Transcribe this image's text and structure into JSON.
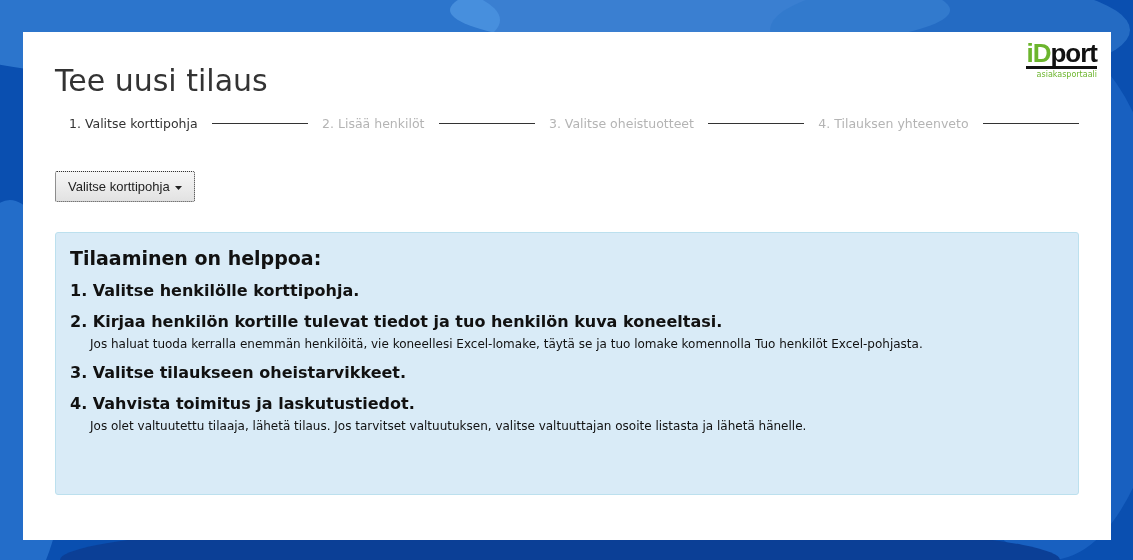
{
  "logo": {
    "brand_start": "iD",
    "brand_end": "port",
    "tagline": "asiakasportaali"
  },
  "title": "Tee uusi tilaus",
  "steps": [
    {
      "label": "1. Valitse korttipohja",
      "selected": true
    },
    {
      "label": "2. Lisää henkilöt",
      "selected": false
    },
    {
      "label": "3. Valitse oheistuotteet",
      "selected": false
    },
    {
      "label": "4. Tilauksen yhteenveto",
      "selected": false
    }
  ],
  "dropdown": {
    "label": "Valitse korttipohja"
  },
  "info": {
    "heading": "Tilaaminen on helppoa:",
    "items": [
      {
        "text": "1. Valitse henkilölle korttipohja."
      },
      {
        "text": "2. Kirjaa henkilön kortille tulevat tiedot ja tuo henkilön kuva koneeltasi.",
        "note": "Jos haluat tuoda kerralla enemmän henkilöitä, vie koneellesi Excel-lomake, täytä se ja tuo lomake komennolla Tuo henkilöt Excel-pohjasta."
      },
      {
        "text": "3. Valitse tilaukseen oheistarvikkeet."
      },
      {
        "text": "4. Vahvista toimitus ja laskutustiedot.",
        "note": "Jos olet valtuutettu tilaaja, lähetä tilaus. Jos tarvitset valtuutuksen, valitse valtuuttajan osoite listasta ja lähetä hänelle."
      }
    ]
  }
}
